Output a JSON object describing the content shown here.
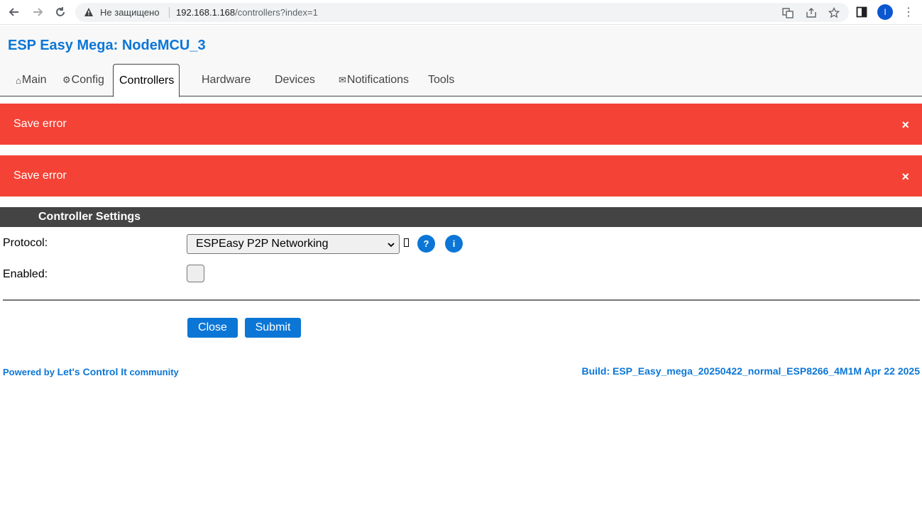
{
  "browser": {
    "insecure_label": "Не защищено",
    "url_host": "192.168.1.168",
    "url_path": "/controllers?index=1",
    "profile_initial": "I"
  },
  "page": {
    "title": "ESP Easy Mega: NodeMCU_3"
  },
  "tabs": [
    {
      "icon": "⌂",
      "label": "Main"
    },
    {
      "icon": "⚙",
      "label": "Config"
    },
    {
      "icon": "",
      "label": "Controllers"
    },
    {
      "icon": "",
      "label": "Hardware"
    },
    {
      "icon": "",
      "label": "Devices"
    },
    {
      "icon": "✉",
      "label": "Notifications"
    },
    {
      "icon": "",
      "label": "Tools"
    }
  ],
  "alerts": [
    {
      "text": "Save error",
      "close": "×"
    },
    {
      "text": "Save error",
      "close": "×"
    }
  ],
  "section": {
    "title": "Controller Settings"
  },
  "form": {
    "protocol_label": "Protocol:",
    "protocol_value": "ESPEasy P2P Networking",
    "help_glyph": "?",
    "info_glyph": "i",
    "enabled_label": "Enabled:"
  },
  "buttons": {
    "close": "Close",
    "submit": "Submit"
  },
  "footer": {
    "powered_by": "Powered by",
    "brand": "Let's Control It",
    "community": "community",
    "build": "Build: ESP_Easy_mega_20250422_normal_ESP8266_4M1M Apr 22 2025"
  },
  "colors": {
    "accent": "#0b76d6",
    "alert": "#f44336",
    "section_bg": "#444444"
  }
}
